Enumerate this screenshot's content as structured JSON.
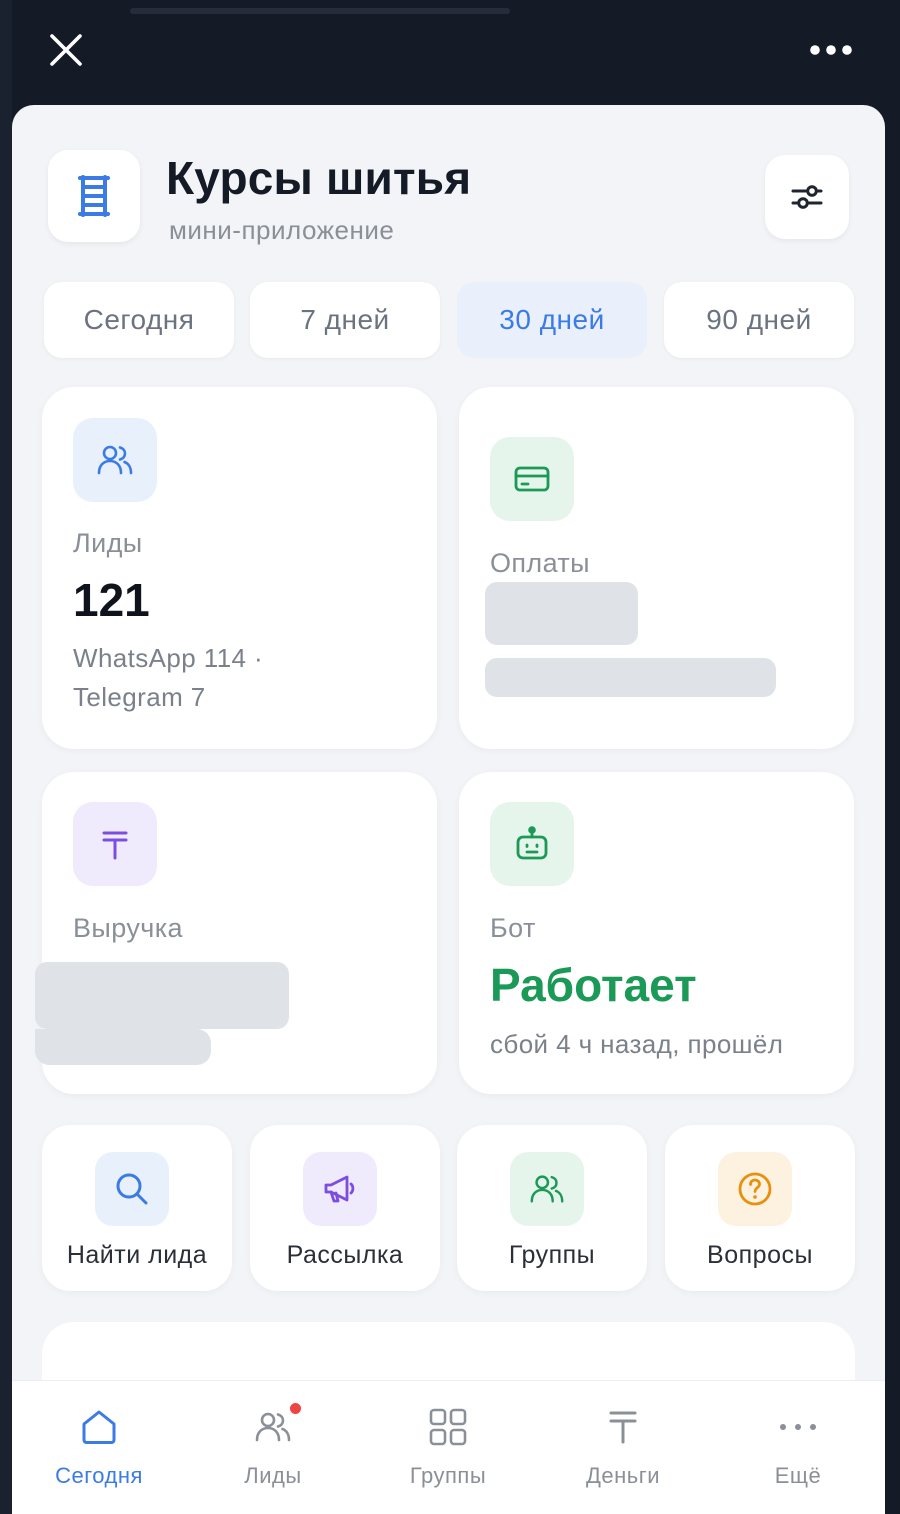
{
  "app": {
    "title": "Курсы шитья",
    "subtitle": "мини-приложение"
  },
  "period_tabs": [
    {
      "label": "Сегодня",
      "active": false
    },
    {
      "label": "7 дней",
      "active": false
    },
    {
      "label": "30 дней",
      "active": true
    },
    {
      "label": "90 дней",
      "active": false
    }
  ],
  "stats": {
    "leads": {
      "label": "Лиды",
      "value": "121",
      "detail_line1": "WhatsApp 114 ·",
      "detail_line2": "Telegram 7",
      "icon": "users-icon"
    },
    "payments": {
      "label": "Оплаты",
      "icon": "credit-card-icon"
    },
    "revenue": {
      "label": "Выручка",
      "icon": "tenge-icon"
    },
    "bot": {
      "label": "Бот",
      "value": "Работает",
      "detail": "сбой 4 ч назад, прошёл",
      "icon": "robot-icon"
    }
  },
  "quick_actions": [
    {
      "label": "Найти лида",
      "icon": "search-icon"
    },
    {
      "label": "Рассылка",
      "icon": "megaphone-icon"
    },
    {
      "label": "Группы",
      "icon": "users-icon"
    },
    {
      "label": "Вопросы",
      "icon": "question-icon"
    }
  ],
  "nav": [
    {
      "label": "Сегодня",
      "icon": "home-icon",
      "active": true
    },
    {
      "label": "Лиды",
      "icon": "users-icon",
      "badge": true
    },
    {
      "label": "Группы",
      "icon": "grid-icon"
    },
    {
      "label": "Деньги",
      "icon": "tenge-icon"
    },
    {
      "label": "Ещё",
      "icon": "more-icon"
    }
  ],
  "colors": {
    "accent": "#3a7be6",
    "success": "#1a9a56",
    "purple": "#7c4ee0",
    "orange": "#e8900e",
    "badge": "#ef4444"
  }
}
